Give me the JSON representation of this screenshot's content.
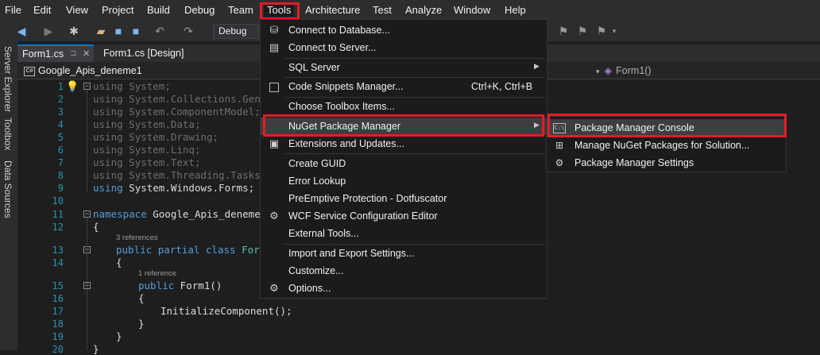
{
  "menubar": {
    "items": [
      "File",
      "Edit",
      "View",
      "Project",
      "Build",
      "Debug",
      "Team",
      "Tools",
      "Architecture",
      "Test",
      "Analyze",
      "Window",
      "Help"
    ]
  },
  "toolbar": {
    "config": "Debug"
  },
  "siderail": {
    "tabs": [
      "Server Explorer",
      "Toolbox",
      "Data Sources"
    ]
  },
  "tabs": [
    {
      "label": "Form1.cs"
    },
    {
      "label": "Form1.cs [Design]"
    }
  ],
  "navbar": {
    "project": "Google_Apis_deneme1",
    "member": "Form1()"
  },
  "code": {
    "line_numbers": [
      "1",
      "2",
      "3",
      "4",
      "5",
      "6",
      "7",
      "8",
      "9",
      "10",
      "11",
      "12",
      "13",
      "14",
      "15",
      "16",
      "17",
      "18",
      "19",
      "20"
    ],
    "usings": [
      "System;",
      "System.Collections.Gener",
      "System.ComponentModel;",
      "System.Data;",
      "System.Drawing;",
      "System.Linq;",
      "System.Text;",
      "System.Threading.Tasks;",
      "System.Windows.Forms;"
    ],
    "kw_using": "using",
    "kw_namespace": "namespace",
    "namespace_name": " Google_Apis_deneme1",
    "kw_public": "public",
    "kw_partial": "partial",
    "kw_class": "class",
    "class_name": " Form1",
    "ctor": " Form1()",
    "init_call": "InitializeComponent();",
    "open_brace": "{",
    "close_brace": "}",
    "refs_class": "3 references",
    "refs_ctor": "1 reference"
  },
  "tools_menu": {
    "items": [
      {
        "label": "Connect to Database...",
        "icon": "database-icon"
      },
      {
        "label": "Connect to Server...",
        "icon": "server-icon"
      },
      {
        "label": "SQL Server"
      },
      {
        "label": "Code Snippets Manager...",
        "shortcut": "Ctrl+K, Ctrl+B",
        "icon": "checkbox-icon"
      },
      {
        "label": "Choose Toolbox Items..."
      },
      {
        "label": "NuGet Package Manager"
      },
      {
        "label": "Extensions and Updates...",
        "icon": "extensions-icon"
      },
      {
        "label": "Create GUID"
      },
      {
        "label": "Error Lookup"
      },
      {
        "label": "PreEmptive Protection - Dotfuscator"
      },
      {
        "label": "WCF Service Configuration Editor",
        "icon": "gear-icon"
      },
      {
        "label": "External Tools..."
      },
      {
        "label": "Import and Export Settings..."
      },
      {
        "label": "Customize..."
      },
      {
        "label": "Options...",
        "icon": "gear-icon"
      }
    ]
  },
  "nuget_submenu": {
    "items": [
      {
        "label": "Package Manager Console",
        "icon_text": "C:\\"
      },
      {
        "label": "Manage NuGet Packages for Solution...",
        "icon": "package-icon"
      },
      {
        "label": "Package Manager Settings",
        "icon": "gear-icon"
      }
    ]
  },
  "colors": {
    "highlight": "#e51c23",
    "accent": "#007acc"
  }
}
